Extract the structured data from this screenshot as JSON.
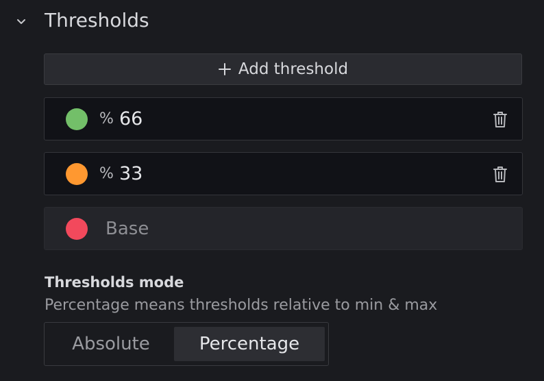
{
  "section": {
    "title": "Thresholds",
    "expand_icon": "chevron-down-icon"
  },
  "add_button": {
    "icon": "plus-icon",
    "label": "Add threshold"
  },
  "thresholds": [
    {
      "color": "#73bf69",
      "unit": "%",
      "value": "66",
      "delete_icon": "trash-icon"
    },
    {
      "color": "#ff9830",
      "unit": "%",
      "value": "33",
      "delete_icon": "trash-icon"
    }
  ],
  "base": {
    "color": "#f2495c",
    "label": "Base"
  },
  "mode": {
    "title": "Thresholds mode",
    "description": "Percentage means thresholds relative to min & max",
    "options": [
      "Absolute",
      "Percentage"
    ],
    "selected": "Percentage"
  }
}
